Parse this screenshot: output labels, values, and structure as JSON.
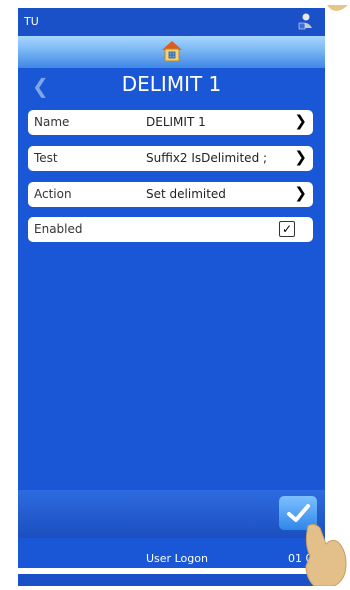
{
  "status": {
    "left_text": "TU",
    "right_icon": "network-user-icon"
  },
  "home": {
    "icon": "home-icon"
  },
  "titlebar": {
    "back_icon": "chevron-left-icon",
    "title": "DELIMIT 1"
  },
  "fields": [
    {
      "label": "Name",
      "value": "DELIMIT 1",
      "control": "chevron-right-icon"
    },
    {
      "label": "Test",
      "value": "Suffix2 IsDelimited ;",
      "control": "chevron-right-icon"
    },
    {
      "label": "Action",
      "value": "Set delimited",
      "control": "chevron-right-icon"
    },
    {
      "label": "Enabled",
      "value": "",
      "control": "checkbox",
      "checked": true
    }
  ],
  "bottombar": {
    "ok_icon": "confirm-icon"
  },
  "footer": {
    "logon": "User Logon",
    "time": "01 0"
  },
  "colors": {
    "primary": "#1a57d6",
    "row": "#ffffff"
  }
}
